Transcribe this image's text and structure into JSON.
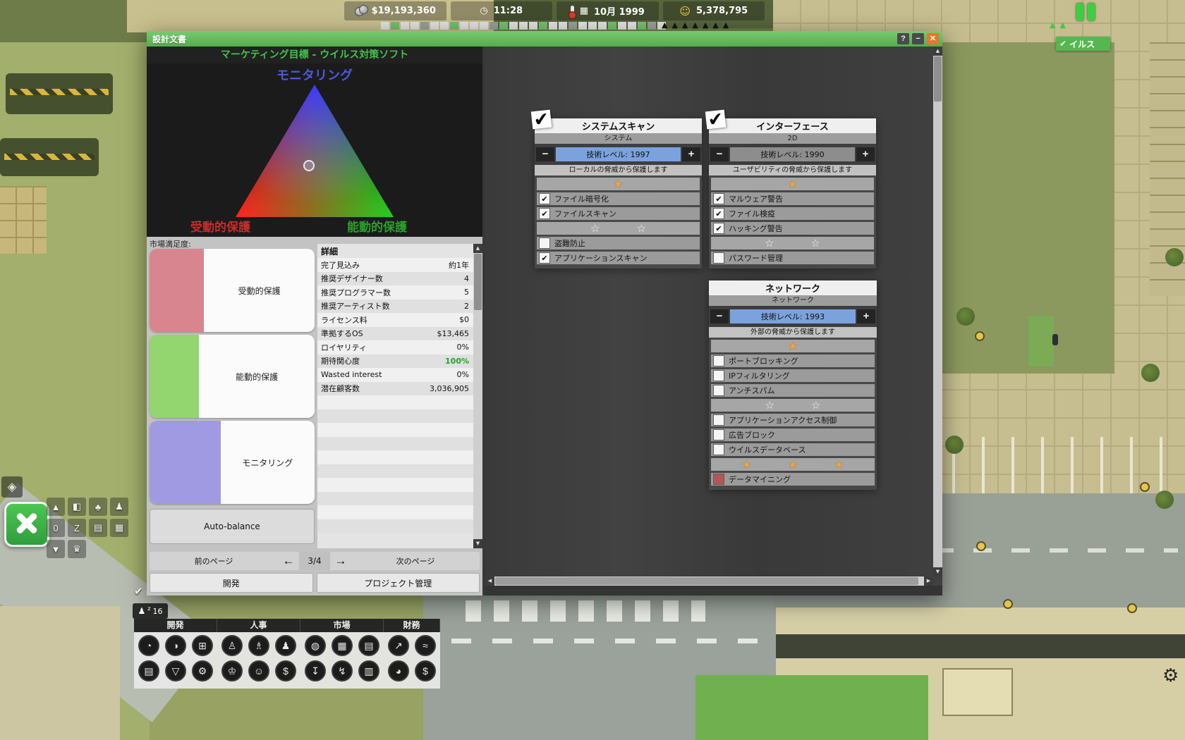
{
  "hud": {
    "money": "$19,193,360",
    "time": "11:28",
    "date": "10月 1999",
    "population": "5,378,795",
    "pause_tag_label": "イルス"
  },
  "window": {
    "title": "設計文書",
    "controls": {
      "help": "?",
      "minimize": "−",
      "close": "✕"
    },
    "marketing_header": "マーケティング目標 - ウイルス対策ソフト",
    "triangle": {
      "top": "モニタリング",
      "bottom_left": "受動的保護",
      "bottom_right": "能動的保護"
    },
    "market": {
      "label": "市場満足度:",
      "bars": [
        {
          "label": "受動的保護",
          "color": "#d8858f",
          "fill": 33
        },
        {
          "label": "能動的保護",
          "color": "#93d56f",
          "fill": 30
        },
        {
          "label": "モニタリング",
          "color": "#a09ae2",
          "fill": 43
        }
      ],
      "auto_balance": "Auto-balance"
    },
    "details": {
      "title": "詳細",
      "rows": [
        {
          "label": "完了見込み",
          "value": "約1年"
        },
        {
          "label": "推奨デザイナー数",
          "value": "4"
        },
        {
          "label": "推奨プログラマー数",
          "value": "5"
        },
        {
          "label": "推奨アーティスト数",
          "value": "2"
        },
        {
          "label": "ライセンス料",
          "value": "$0"
        },
        {
          "label": "準拠するOS",
          "value": "$13,465"
        },
        {
          "label": "ロイヤリティ",
          "value": "0%"
        },
        {
          "label": "期待関心度",
          "value": "100%",
          "highlight": true
        },
        {
          "label": "Wasted interest",
          "value": "0%"
        },
        {
          "label": "潜在顧客数",
          "value": "3,036,905"
        }
      ]
    },
    "pager": {
      "prev": "前のページ",
      "page": "3/4",
      "next": "次のページ"
    },
    "footer_tabs": [
      {
        "label": "開発"
      },
      {
        "label": "プロジェクト管理"
      }
    ]
  },
  "feature_panels": [
    {
      "title": "システムスキャン",
      "subtitle": "システム",
      "checked": true,
      "tech_label": "技術レベル: 1997",
      "tech_active": true,
      "description": "ローカルの脅威から保護します",
      "rows": [
        {
          "type": "stars",
          "stars": [
            {
              "filled": true
            }
          ]
        },
        {
          "type": "item",
          "label": "ファイル暗号化",
          "checked": true
        },
        {
          "type": "item",
          "label": "ファイルスキャン",
          "checked": true
        },
        {
          "type": "stars",
          "stars": [
            {
              "filled": false
            },
            {
              "filled": false
            }
          ]
        },
        {
          "type": "item",
          "label": "盗難防止",
          "checked": false
        },
        {
          "type": "item",
          "label": "アプリケーションスキャン",
          "checked": true
        }
      ]
    },
    {
      "title": "インターフェース",
      "subtitle": "2D",
      "checked": true,
      "tech_label": "技術レベル: 1990",
      "tech_active": false,
      "description": "ユーザビリティの脅威から保護します",
      "rows": [
        {
          "type": "stars",
          "stars": [
            {
              "filled": true
            }
          ]
        },
        {
          "type": "item",
          "label": "マルウェア警告",
          "checked": true
        },
        {
          "type": "item",
          "label": "ファイル検疫",
          "checked": true
        },
        {
          "type": "item",
          "label": "ハッキング警告",
          "checked": true
        },
        {
          "type": "stars",
          "stars": [
            {
              "filled": false
            },
            {
              "filled": false
            }
          ]
        },
        {
          "type": "item",
          "label": "パスワード管理",
          "checked": false
        }
      ]
    },
    {
      "title": "ネットワーク",
      "subtitle": "ネットワーク",
      "checked": false,
      "tech_label": "技術レベル: 1993",
      "tech_active": true,
      "description": "外部の脅威から保護します",
      "rows": [
        {
          "type": "stars",
          "stars": [
            {
              "filled": true
            }
          ]
        },
        {
          "type": "item",
          "label": "ポートブロッキング",
          "checked": false
        },
        {
          "type": "item",
          "label": "IPフィルタリング",
          "checked": false
        },
        {
          "type": "item",
          "label": "アンチスパム",
          "checked": false
        },
        {
          "type": "stars",
          "stars": [
            {
              "filled": false
            },
            {
              "filled": false
            }
          ]
        },
        {
          "type": "item",
          "label": "アプリケーションアクセス制御",
          "checked": false
        },
        {
          "type": "item",
          "label": "広告ブロック",
          "checked": false
        },
        {
          "type": "item",
          "label": "ウイルスデータベース",
          "checked": false
        },
        {
          "type": "stars",
          "stars": [
            {
              "filled": true
            },
            {
              "filled": true
            },
            {
              "filled": true
            }
          ]
        },
        {
          "type": "item",
          "label": "データマイニング",
          "checked": false,
          "negative": true
        }
      ]
    }
  ],
  "toolbar": {
    "grid": [
      {
        "name": "up-arrow-button",
        "glyph": "▲"
      },
      {
        "name": "furniture-tool",
        "glyph": "◧"
      },
      {
        "name": "tree-tool",
        "glyph": "♣"
      },
      {
        "name": "staff-tool",
        "glyph": "♟"
      },
      {
        "name": "floor-counter",
        "glyph": "0"
      },
      {
        "name": "road-tool",
        "glyph": "Z"
      },
      {
        "name": "rooms-tool",
        "glyph": "▤"
      },
      {
        "name": "building-tool",
        "glyph": "▦"
      },
      {
        "name": "down-arrow-button",
        "glyph": "▼"
      },
      {
        "name": "badge-tool",
        "glyph": "♛"
      }
    ],
    "sleep_count": "16"
  },
  "menu": {
    "groups": [
      {
        "label": "開発",
        "icons": [
          [
            {
              "name": "projects-icon",
              "glyph": "◔"
            },
            {
              "name": "globe-icon",
              "glyph": "◑"
            },
            {
              "name": "computer-icon",
              "glyph": "⊞"
            }
          ],
          [
            {
              "name": "documents-icon",
              "glyph": "▤"
            },
            {
              "name": "research-icon",
              "glyph": "▽"
            },
            {
              "name": "settings-icon",
              "glyph": "⚙"
            }
          ]
        ]
      },
      {
        "label": "人事",
        "icons": [
          [
            {
              "name": "person-icon",
              "glyph": "♙"
            },
            {
              "name": "hire-person-icon",
              "glyph": "♗"
            },
            {
              "name": "team-icon",
              "glyph": "♟"
            }
          ],
          [
            {
              "name": "employee-icon",
              "glyph": "♔"
            },
            {
              "name": "mood-icon",
              "glyph": "☺"
            },
            {
              "name": "salary-icon",
              "glyph": "$"
            }
          ]
        ]
      },
      {
        "label": "市場",
        "icons": [
          [
            {
              "name": "world-market-icon",
              "glyph": "◍"
            },
            {
              "name": "market-grid-icon",
              "glyph": "▦"
            },
            {
              "name": "news-icon",
              "glyph": "▤"
            }
          ],
          [
            {
              "name": "distribution-icon",
              "glyph": "↧"
            },
            {
              "name": "shipping-icon",
              "glyph": "↯"
            },
            {
              "name": "calendar-icon",
              "glyph": "▥"
            }
          ]
        ]
      },
      {
        "label": "財務",
        "icons": [
          [
            {
              "name": "growth-chart-icon",
              "glyph": "↗"
            },
            {
              "name": "line-chart-icon",
              "glyph": "≈"
            }
          ],
          [
            {
              "name": "pie-chart-icon",
              "glyph": "◕"
            },
            {
              "name": "money-icon",
              "glyph": "$"
            }
          ]
        ]
      }
    ]
  }
}
